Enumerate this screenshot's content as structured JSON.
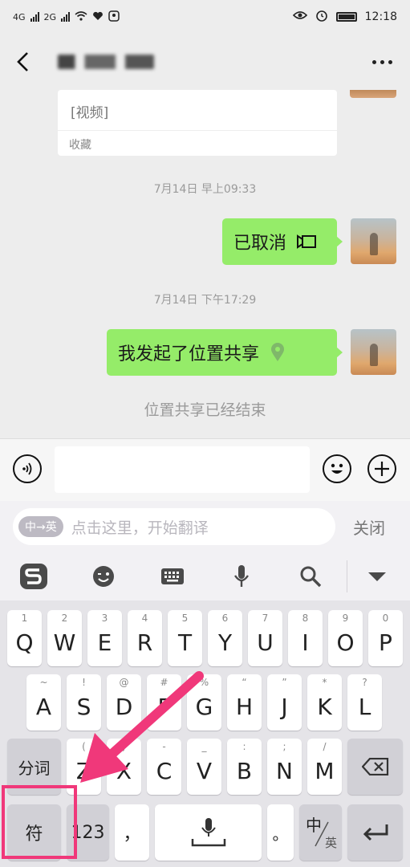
{
  "status_bar": {
    "network_1": "4G",
    "network_2": "2G",
    "time": "12:18"
  },
  "header": {
    "back_icon": "chevron-left-icon",
    "more_icon": "more-dots-icon"
  },
  "chat": {
    "favorite_card": {
      "title": "[视频]",
      "source": "收藏"
    },
    "messages": [
      {
        "time": "7月14日 早上09:33",
        "text": "已取消",
        "icon": "video-call-icon"
      },
      {
        "time": "7月14日 下午17:29",
        "text": "我发起了位置共享",
        "icon": "location-pin-icon"
      }
    ],
    "system_notice": "位置共享已经结束"
  },
  "input_bar": {
    "voice_icon": "voice-icon",
    "message_value": "",
    "emoji_icon": "emoji-icon",
    "plus_icon": "plus-icon"
  },
  "translate_bar": {
    "lang_pill": "中→英",
    "hint": "点击这里，开始翻译",
    "close_label": "关闭"
  },
  "keyboard_toolbar": {
    "icons": [
      "sogou-logo-icon",
      "emoji-face-icon",
      "keyboard-icon",
      "microphone-icon",
      "search-icon",
      "collapse-triangle-icon"
    ]
  },
  "keyboard": {
    "row1": [
      {
        "main": "Q",
        "sub": "1"
      },
      {
        "main": "W",
        "sub": "2"
      },
      {
        "main": "E",
        "sub": "3"
      },
      {
        "main": "R",
        "sub": "4"
      },
      {
        "main": "T",
        "sub": "5"
      },
      {
        "main": "Y",
        "sub": "6"
      },
      {
        "main": "U",
        "sub": "7"
      },
      {
        "main": "I",
        "sub": "8"
      },
      {
        "main": "O",
        "sub": "9"
      },
      {
        "main": "P",
        "sub": "0"
      }
    ],
    "row2": [
      {
        "main": "A",
        "sub": "~"
      },
      {
        "main": "S",
        "sub": "!"
      },
      {
        "main": "D",
        "sub": "@"
      },
      {
        "main": "F",
        "sub": "#"
      },
      {
        "main": "G",
        "sub": "%"
      },
      {
        "main": "H",
        "sub": "“"
      },
      {
        "main": "J",
        "sub": "”"
      },
      {
        "main": "K",
        "sub": "*"
      },
      {
        "main": "L",
        "sub": "?"
      }
    ],
    "row3_left": "分词",
    "row3": [
      {
        "main": "Z",
        "sub": "("
      },
      {
        "main": "X",
        "sub": ")"
      },
      {
        "main": "C",
        "sub": "-"
      },
      {
        "main": "V",
        "sub": "_"
      },
      {
        "main": "B",
        "sub": ":"
      },
      {
        "main": "N",
        "sub": ";"
      },
      {
        "main": "M",
        "sub": "/"
      }
    ],
    "backspace_icon": "backspace-icon",
    "row4": {
      "symbols": "符",
      "numbers": "123",
      "comma": "，",
      "space_icon": "microphone-icon",
      "period": "。",
      "lang_top": "中",
      "lang_bottom": "英",
      "enter_icon": "enter-icon"
    }
  },
  "annotation": {
    "color": "#f0387a",
    "target": "符"
  }
}
